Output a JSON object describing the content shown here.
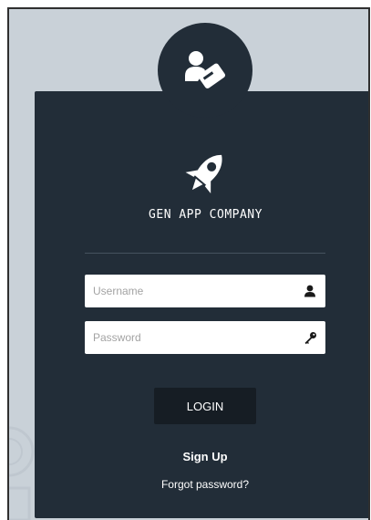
{
  "app": {
    "company_name": "GEN APP COMPANY"
  },
  "form": {
    "username_placeholder": "Username",
    "password_placeholder": "Password",
    "login_label": "LOGIN",
    "signup_label": "Sign Up",
    "forgot_label": "Forgot password?"
  },
  "icons": {
    "avatar": "user-badge-icon",
    "logo": "rocket-icon",
    "username": "user-icon",
    "password": "key-icon"
  },
  "colors": {
    "page_background": "#c9d1d8",
    "card_background": "#222d38",
    "button_background": "#161d24",
    "text": "#ffffff"
  }
}
